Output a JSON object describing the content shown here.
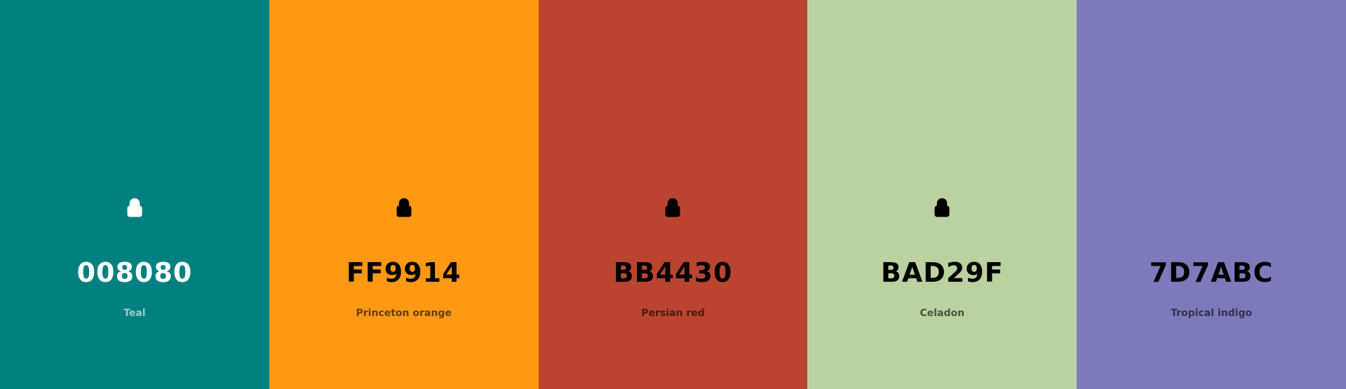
{
  "palette": [
    {
      "hex": "008080",
      "name": "Teal",
      "color": "#008080",
      "locked": true,
      "text_theme": "light"
    },
    {
      "hex": "FF9914",
      "name": "Princeton orange",
      "color": "#FF9914",
      "locked": true,
      "text_theme": "dark"
    },
    {
      "hex": "BB4430",
      "name": "Persian red",
      "color": "#BB4430",
      "locked": true,
      "text_theme": "dark"
    },
    {
      "hex": "BAD29F",
      "name": "Celadon",
      "color": "#BAD29F",
      "locked": true,
      "text_theme": "dark"
    },
    {
      "hex": "7D7ABC",
      "name": "Tropical indigo",
      "color": "#7D7ABC",
      "locked": false,
      "text_theme": "dark"
    }
  ],
  "icons": {
    "lock": "lock-icon"
  }
}
